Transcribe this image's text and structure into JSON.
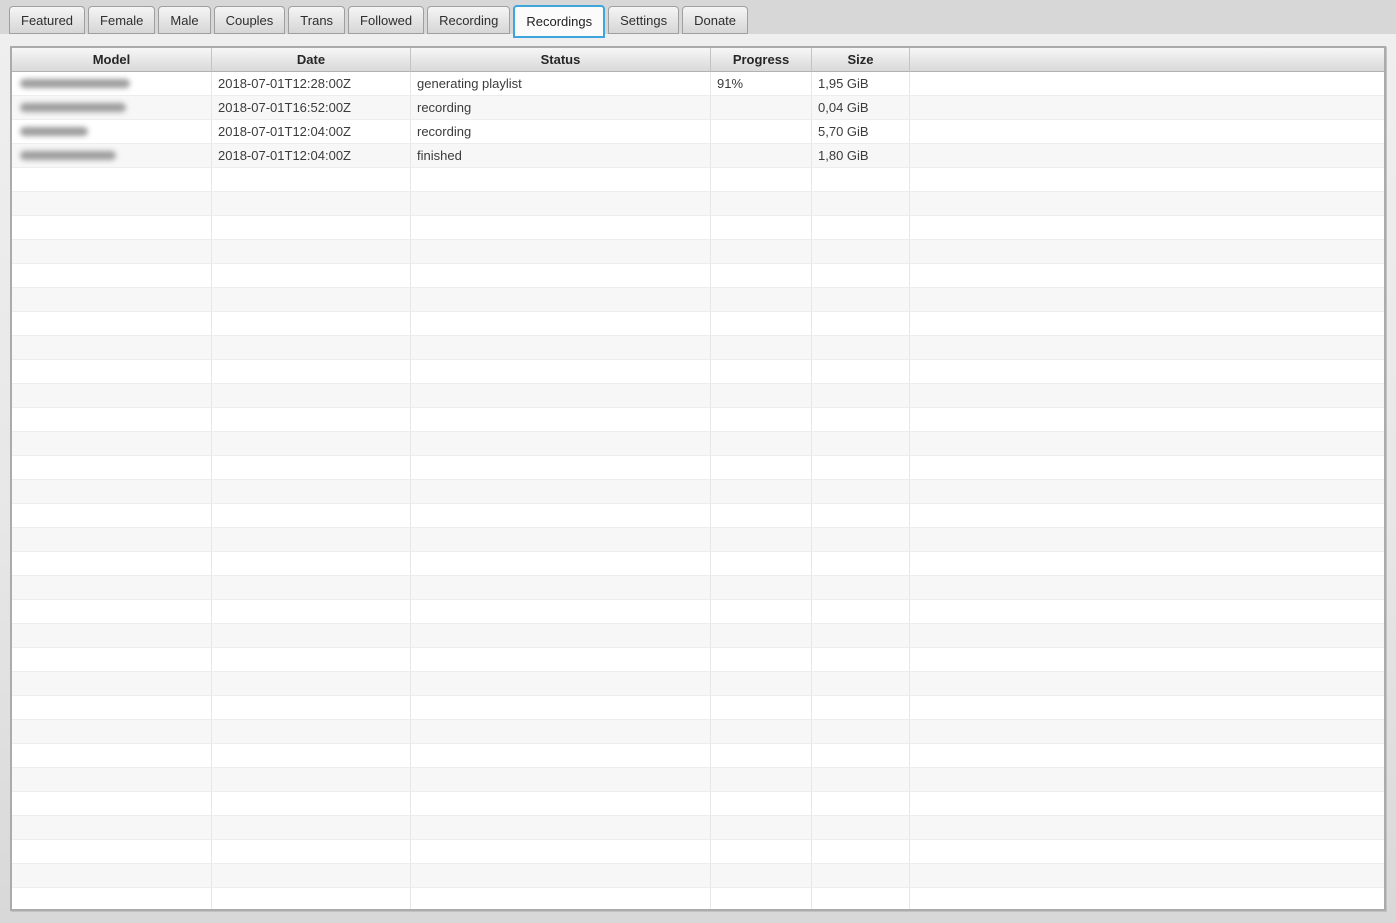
{
  "tabs": [
    {
      "label": "Featured",
      "active": false
    },
    {
      "label": "Female",
      "active": false
    },
    {
      "label": "Male",
      "active": false
    },
    {
      "label": "Couples",
      "active": false
    },
    {
      "label": "Trans",
      "active": false
    },
    {
      "label": "Followed",
      "active": false
    },
    {
      "label": "Recording",
      "active": false
    },
    {
      "label": "Recordings",
      "active": true
    },
    {
      "label": "Settings",
      "active": false
    },
    {
      "label": "Donate",
      "active": false
    }
  ],
  "table": {
    "columns": [
      {
        "label": "Model"
      },
      {
        "label": "Date"
      },
      {
        "label": "Status"
      },
      {
        "label": "Progress"
      },
      {
        "label": "Size"
      },
      {
        "label": ""
      }
    ],
    "rows": [
      {
        "model_redacted": true,
        "model_blur_width": 110,
        "date": "2018-07-01T12:28:00Z",
        "status": "generating playlist",
        "progress": "91%",
        "size": "1,95 GiB"
      },
      {
        "model_redacted": true,
        "model_blur_width": 106,
        "date": "2018-07-01T16:52:00Z",
        "status": "recording",
        "progress": "",
        "size": "0,04 GiB"
      },
      {
        "model_redacted": true,
        "model_blur_width": 68,
        "date": "2018-07-01T12:04:00Z",
        "status": "recording",
        "progress": "",
        "size": "5,70 GiB"
      },
      {
        "model_redacted": true,
        "model_blur_width": 96,
        "date": "2018-07-01T12:04:00Z",
        "status": "finished",
        "progress": "",
        "size": "1,80 GiB"
      }
    ],
    "empty_row_count": 31
  },
  "colors": {
    "active_tab_border": "#3ea6db",
    "window_background": "#d7d7d7",
    "row_alternate": "#f7f7f7",
    "header_text": "#262626",
    "cell_text": "#3b3b3b"
  }
}
